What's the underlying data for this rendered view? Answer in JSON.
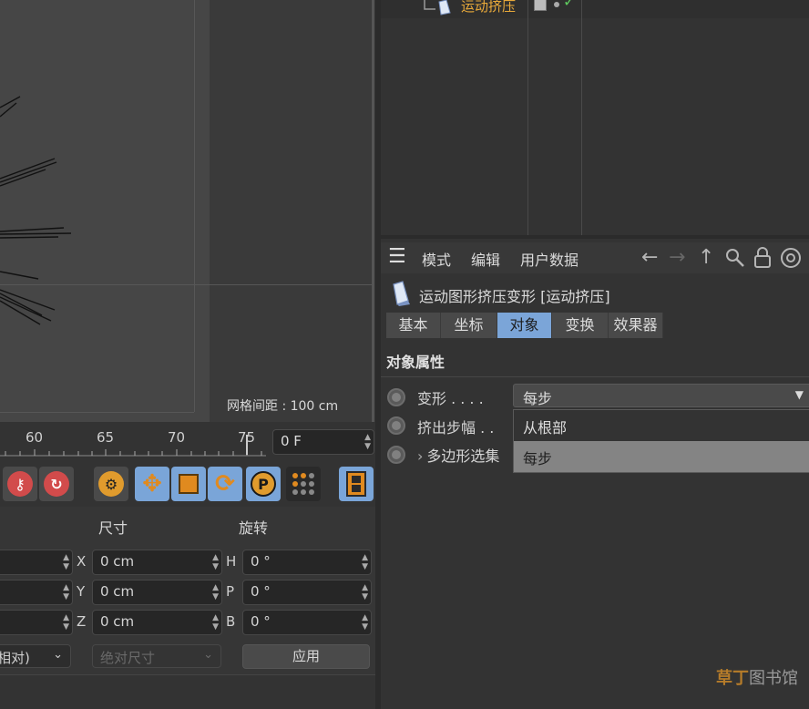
{
  "viewport": {
    "grid_spacing": "网格间距 : 100 cm"
  },
  "timeline": {
    "ticks": [
      "60",
      "65",
      "70",
      "75"
    ],
    "current_frame": "0 F"
  },
  "coordinates": {
    "size_header": "尺寸",
    "rotation_header": "旋转",
    "size_axes": [
      "X",
      "Y",
      "Z"
    ],
    "size_values": [
      "0 cm",
      "0 cm",
      "0 cm"
    ],
    "rot_axes": [
      "H",
      "P",
      "B"
    ],
    "rot_values": [
      "0 °",
      "0 °",
      "0 °"
    ],
    "mode_select": "相对)",
    "size_mode_select": "绝对尺寸",
    "apply_label": "应用"
  },
  "object_manager": {
    "object_name": "运动挤压"
  },
  "attribute_manager": {
    "menu": [
      "模式",
      "编辑",
      "用户数据"
    ],
    "object_title": "运动图形挤压变形 [运动挤压]",
    "tabs": [
      "基本",
      "坐标",
      "对象",
      "变换",
      "效果器"
    ],
    "active_tab": "对象",
    "section_title": "对象属性",
    "props": {
      "deform_label": "变形 . . . .",
      "extrude_steps_label": "挤出步幅 . .",
      "polygon_selection_label": "多边形选集",
      "deform_value": "每步"
    },
    "dropdown_options": [
      "从根部",
      "每步"
    ],
    "dropdown_selected": "每步"
  },
  "watermark": {
    "brand": "草丁",
    "rest": "图书馆"
  },
  "colors": {
    "accent_blue": "#7ba5d8",
    "object_orange": "#e8a93a"
  }
}
